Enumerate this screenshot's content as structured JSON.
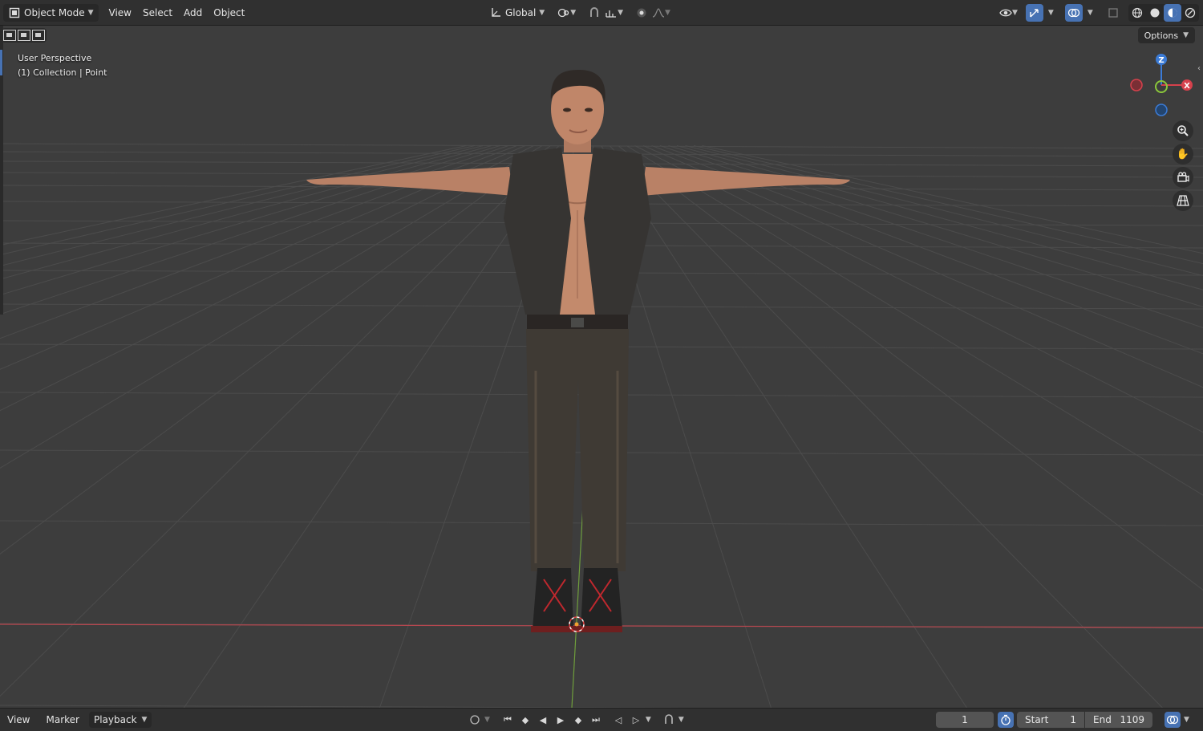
{
  "header": {
    "mode": "Object Mode",
    "menus": [
      "View",
      "Select",
      "Add",
      "Object"
    ],
    "transform_orientation": "Global",
    "options_label": "Options"
  },
  "viewport": {
    "perspective": "User Perspective",
    "collection_info": "(1) Collection | Point",
    "gizmo": {
      "z_label": "Z",
      "x_label": "X"
    }
  },
  "timeline": {
    "menus": [
      "View",
      "Marker"
    ],
    "playback": "Playback",
    "current_frame": "1",
    "start_label": "Start",
    "start_value": "1",
    "end_label": "End",
    "end_value": "1109"
  },
  "colors": {
    "accent": "#4772b3",
    "x_axis": "#d6414c",
    "y_axis": "#8bc73b",
    "z_axis": "#3b7bd6",
    "viewport_bg": "#3d3d3d"
  }
}
